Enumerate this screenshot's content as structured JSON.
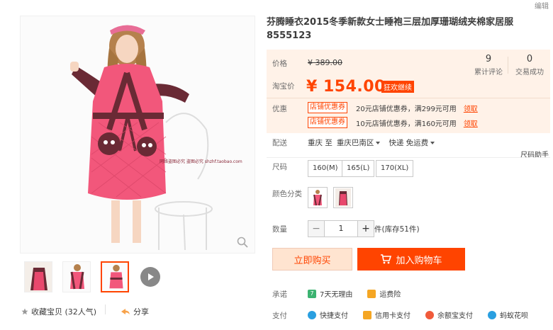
{
  "header": {
    "edit_label": "编辑"
  },
  "product": {
    "title": "芬腾睡衣2015冬季新款女士睡袍三层加厚珊瑚绒夹棉家居服 8555123"
  },
  "price": {
    "orig_label": "价格",
    "orig_value": "¥ 389.00",
    "promo_label": "淘宝价",
    "promo_value": "¥ 154.00",
    "promo_badge": "狂欢继续",
    "reviews_count": "9",
    "reviews_label": "累计评论",
    "sales_count": "0",
    "sales_label": "交易成功",
    "coupon_label": "优惠",
    "coupons": [
      {
        "tag": "店铺优惠券",
        "text": "20元店铺优惠券，满299元可用",
        "action": "领取"
      },
      {
        "tag": "店铺优惠券",
        "text": "10元店铺优惠券，满160元可用",
        "action": "领取"
      }
    ]
  },
  "delivery": {
    "label": "配送",
    "from": "重庆 至",
    "to": "重庆巴南区",
    "method": "快递 免运费"
  },
  "size_helper": "尺码助手",
  "size": {
    "label": "尺码",
    "options": [
      "160(M)",
      "165(L)",
      "170(XL)"
    ]
  },
  "color": {
    "label": "颜色分类"
  },
  "quantity": {
    "label": "数量",
    "minus": "−",
    "value": "1",
    "plus": "+",
    "stock": "件(库存51件)"
  },
  "actions": {
    "buy": "立即购买",
    "cart": "加入购物车"
  },
  "promise": {
    "label": "承诺",
    "items": [
      "7天无理由",
      "运费险"
    ]
  },
  "payment": {
    "label": "支付",
    "items": [
      "快捷支付",
      "信用卡支付",
      "余额宝支付",
      "蚂蚁花呗"
    ]
  },
  "gallery": {
    "watermark": "网络盗图必究 盗图必究 shzhf.taobao.com",
    "collect_label": "收藏宝贝 (32人气)",
    "share_label": "分享"
  },
  "colors": {
    "accent": "#ff4400",
    "price_bg": "#fff2e8"
  }
}
